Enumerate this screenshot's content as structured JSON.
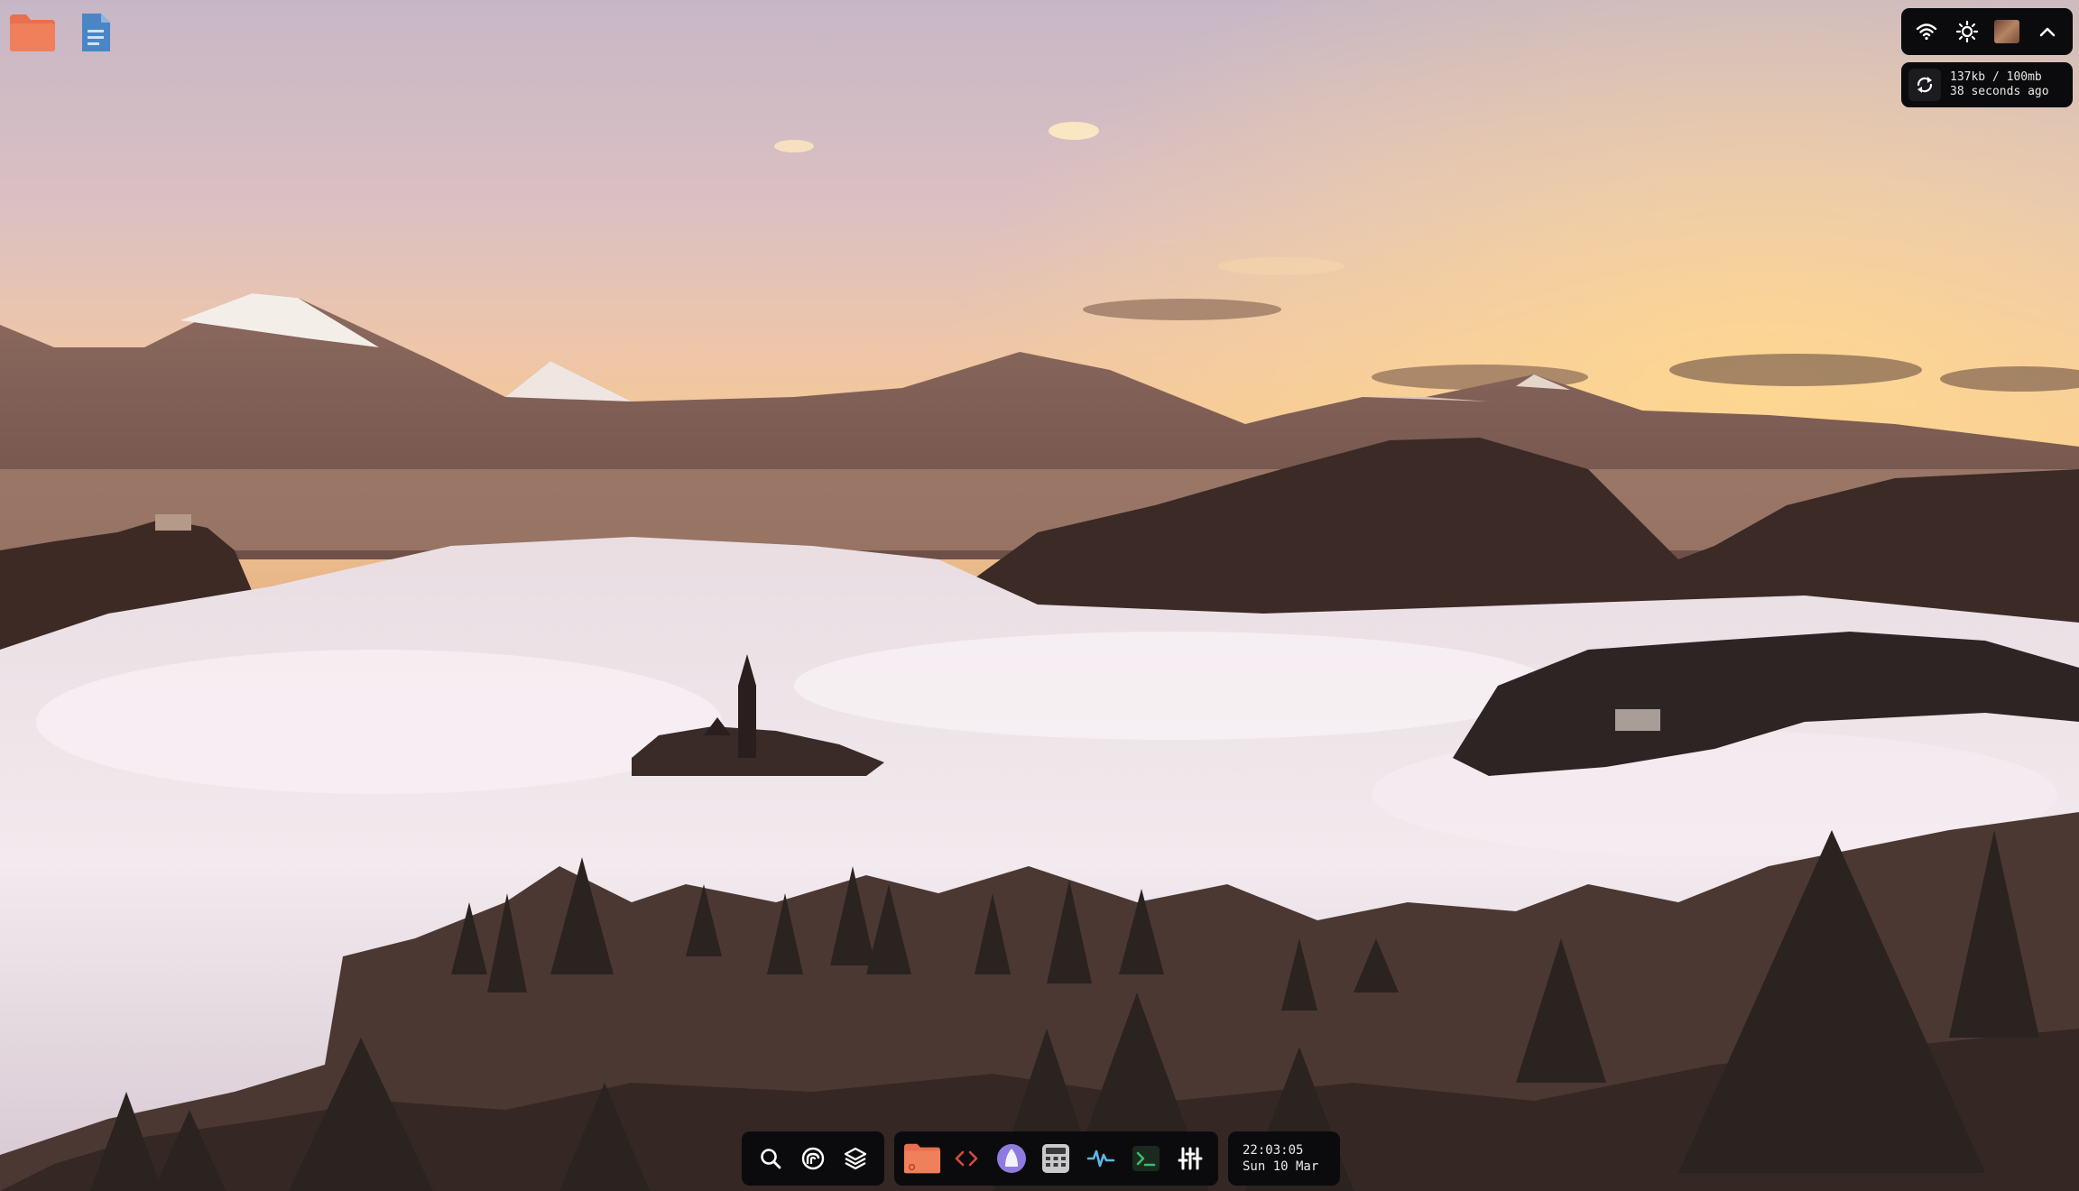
{
  "desktop": {
    "icons": [
      {
        "name": "folder",
        "icon": "folder-icon",
        "color": "#e8704f"
      },
      {
        "name": "document",
        "icon": "document-icon",
        "color": "#4a86c5"
      }
    ]
  },
  "tray": {
    "icons": [
      "wifi-icon",
      "brightness-icon",
      "user-avatar",
      "chevron-up-icon"
    ]
  },
  "sync": {
    "usage": "137kb / 100mb",
    "last_sync": "38 seconds ago"
  },
  "dock": {
    "left": [
      "search-icon",
      "launcher-icon",
      "layers-icon"
    ],
    "apps": [
      "folder-icon",
      "code-icon",
      "tuxedo-icon",
      "calculator-icon",
      "activity-icon",
      "terminal-icon",
      "mixer-icon"
    ],
    "clock": {
      "time": "22:03:05",
      "date": "Sun 10 Mar"
    }
  },
  "colors": {
    "panel_bg": "#0b0b0d",
    "folder": "#e8704f",
    "code": "#d74a3e",
    "accent_purple": "#8f7be0",
    "activity": "#5fb6e6",
    "terminal": "#3bbc6d"
  }
}
